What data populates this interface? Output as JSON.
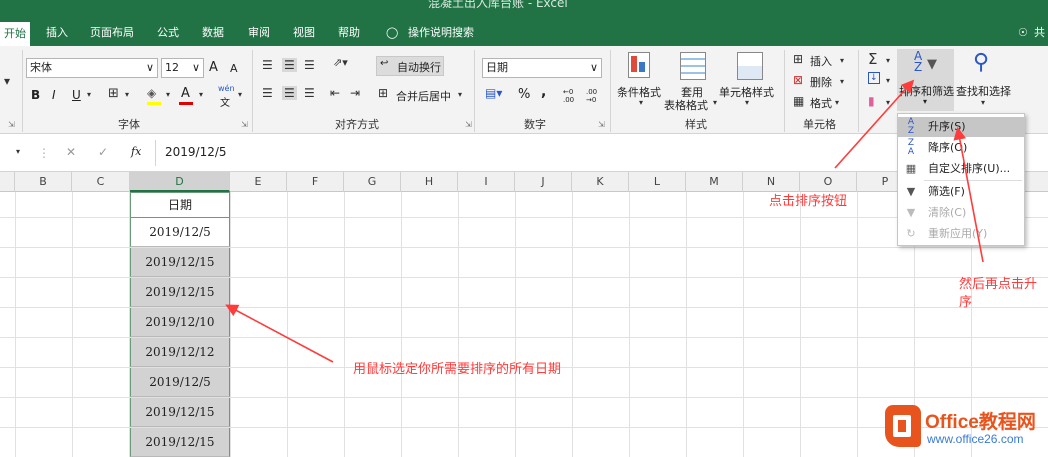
{
  "title_bar": {
    "title": "混凝土出入库台账 - Excel"
  },
  "tabs": [
    "开始",
    "插入",
    "页面布局",
    "公式",
    "数据",
    "审阅",
    "视图",
    "帮助"
  ],
  "tell_me": "操作说明搜索",
  "share": "共",
  "ribbon": {
    "font_name": "宋体",
    "font_size": "12",
    "grow_font": "A",
    "shrink_font": "A",
    "bold": "B",
    "italic": "I",
    "underline": "U",
    "font_color_glyph": "A",
    "wen_glyph": "wén",
    "wen_char": "文",
    "font_group": "字体",
    "wrap_text": "自动换行",
    "merge_center": "合并后居中",
    "alignment_group": "对齐方式",
    "number_format": "日期",
    "percent": "%",
    "comma": ",",
    "increase_decimal": "←0 .00",
    "decrease_decimal": ".00 →0",
    "number_group": "数字",
    "conditional_format": "条件格式",
    "format_as_table_1": "套用",
    "format_as_table_2": "表格格式",
    "cell_styles": "单元格样式",
    "styles_group": "样式",
    "insert": "插入",
    "delete": "删除",
    "format": "格式",
    "cells_group": "单元格",
    "sort_filter": "排序和筛选",
    "find_select": "查找和选择"
  },
  "formula_bar": {
    "fx": "fx",
    "value": "2019/12/5"
  },
  "columns": [
    "B",
    "C",
    "D",
    "E",
    "F",
    "G",
    "H",
    "I",
    "J",
    "K",
    "L",
    "M",
    "N",
    "O",
    "P"
  ],
  "cells": {
    "header": "日期",
    "values": [
      "2019/12/5",
      "2019/12/15",
      "2019/12/15",
      "2019/12/10",
      "2019/12/12",
      "2019/12/5",
      "2019/12/15",
      "2019/12/15"
    ]
  },
  "sort_menu": {
    "items": [
      {
        "label": "升序(S)",
        "icon": "sort-ascending-icon",
        "enabled": true
      },
      {
        "label": "降序(O)",
        "icon": "sort-descending-icon",
        "enabled": true
      },
      {
        "label": "自定义排序(U)...",
        "icon": "custom-sort-icon",
        "enabled": true
      },
      {
        "label": "筛选(F)",
        "icon": "filter-icon",
        "enabled": true
      },
      {
        "label": "清除(C)",
        "icon": "clear-filter-icon",
        "enabled": false
      },
      {
        "label": "重新应用(Y)",
        "icon": "reapply-icon",
        "enabled": false
      }
    ]
  },
  "annotations": {
    "click_sort": "点击排序按钮",
    "select_dates": "用鼠标选定你所需要排序的所有日期",
    "then_asc_1": "然后再点击升",
    "then_asc_2": "序"
  },
  "logo": {
    "brand": "Office教程网",
    "url": "www.office26.com"
  },
  "colors": {
    "excel_green": "#217346",
    "annotation_red": "#ff3b3b",
    "logo_orange": "#e8541e"
  }
}
